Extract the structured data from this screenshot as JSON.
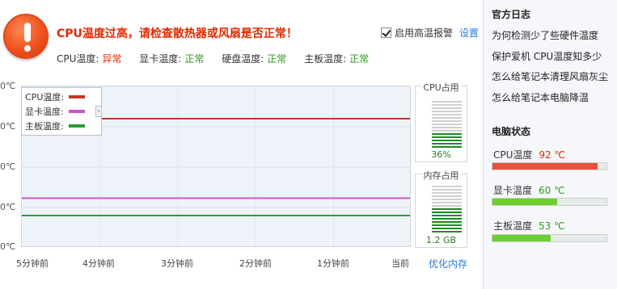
{
  "alert": {
    "title": "CPU温度过高，请检查散热器或风扇是否正常！",
    "alarm_label": "启用高温报警",
    "alarm_checked": true,
    "settings_link": "设置"
  },
  "status": [
    {
      "label": "CPU温度:",
      "value": "异常",
      "state": "bad"
    },
    {
      "label": "显卡温度:",
      "value": "正常",
      "state": "ok"
    },
    {
      "label": "硬盘温度:",
      "value": "正常",
      "state": "ok"
    },
    {
      "label": "主板温度:",
      "value": "正常",
      "state": "ok"
    }
  ],
  "chart": {
    "y_ticks": [
      "0℃",
      "0℃",
      "0℃",
      "0℃",
      "0℃"
    ],
    "x_ticks": [
      "5分钟前",
      "4分钟前",
      "3分钟前",
      "2分钟前",
      "1分钟前",
      "当前"
    ],
    "legend": [
      {
        "name": "CPU温度:",
        "color": "#c0392b"
      },
      {
        "name": "显卡温度:",
        "color": "#cc55cc"
      },
      {
        "name": "主板温度:",
        "color": "#2a9a3a"
      }
    ],
    "legend_expand_icon": "chevron-right-icon"
  },
  "chart_data": {
    "type": "line",
    "x": [
      0,
      1,
      2,
      3,
      4,
      5
    ],
    "series": [
      {
        "name": "CPU温度",
        "color": "#c0392b",
        "values": [
          92,
          92,
          92,
          92,
          92,
          92
        ]
      },
      {
        "name": "显卡温度",
        "color": "#cc55cc",
        "values": [
          60,
          60,
          60,
          60,
          60,
          60
        ]
      },
      {
        "name": "主板温度",
        "color": "#2a9a3a",
        "values": [
          53,
          53,
          53,
          53,
          53,
          53
        ]
      }
    ],
    "grid": true,
    "legend_position": "top-left"
  },
  "gauges": {
    "cpu": {
      "title": "CPU占用",
      "value": "36%",
      "fraction": 0.36
    },
    "mem": {
      "title": "内存占用",
      "value": "1.2 GB",
      "fraction": 0.55
    },
    "optimize_link": "优化内存"
  },
  "sidebar": {
    "log_title": "官方日志",
    "links": [
      "为何检测少了些硬件温度",
      "保护爱机 CPU温度知多少",
      "怎么给笔记本清理风扇灰尘",
      "怎么给笔记本电脑降温"
    ],
    "pc_status_title": "电脑状态",
    "temps": [
      {
        "label": "CPU温度",
        "value": "92 ℃",
        "state": "bad",
        "fraction": 0.92,
        "color": "#e8503a"
      },
      {
        "label": "显卡温度",
        "value": "60 ℃",
        "state": "ok",
        "fraction": 0.57,
        "color": "#6ccf2e"
      },
      {
        "label": "主板温度",
        "value": "53 ℃",
        "state": "ok",
        "fraction": 0.51,
        "color": "#6ccf2e"
      }
    ]
  }
}
